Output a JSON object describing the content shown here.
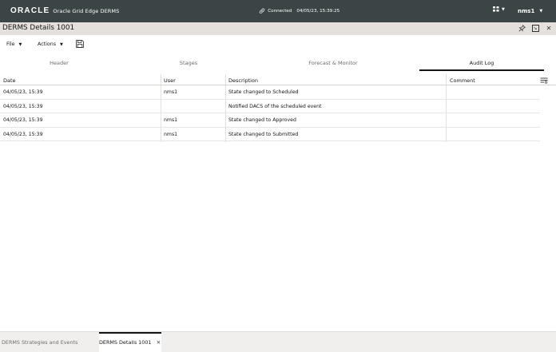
{
  "topbar": {
    "logo": "ORACLE",
    "app_name": "Oracle Grid Edge DERMS",
    "connection_status": "Connected",
    "timestamp": "04/05/23, 15:39:25",
    "user": "nms1",
    "grid_icon": "apps-grid-icon",
    "colors": {
      "bar_bg": "#3c4545",
      "text": "#ffffff"
    }
  },
  "window": {
    "title": "DERMS Details 1001",
    "controls": [
      "pin-icon",
      "maximize-icon",
      "close-icon"
    ]
  },
  "toolbar": {
    "file_label": "File",
    "actions_label": "Actions",
    "save_icon": "save-icon"
  },
  "tabs": [
    {
      "label": "Header",
      "active": false
    },
    {
      "label": "Stages",
      "active": false
    },
    {
      "label": "Forecast & Monitor",
      "active": false
    },
    {
      "label": "Audit Log",
      "active": true
    }
  ],
  "audit_table": {
    "columns": [
      "Date",
      "User",
      "Description",
      "Comment"
    ],
    "rows": [
      {
        "date": "04/05/23, 15:39",
        "user": "nms1",
        "description": "State changed to Scheduled",
        "comment": ""
      },
      {
        "date": "04/05/23, 15:39",
        "user": "",
        "description": "Notified DACS of the scheduled event",
        "comment": ""
      },
      {
        "date": "04/05/23, 15:39",
        "user": "nms1",
        "description": "State changed to Approved",
        "comment": ""
      },
      {
        "date": "04/05/23, 15:39",
        "user": "nms1",
        "description": "State changed to Submitted",
        "comment": ""
      }
    ]
  },
  "bottom_tabs": [
    {
      "label": "DERMS Strategies and Events",
      "active": false
    },
    {
      "label": "DERMS Details 1001",
      "active": true,
      "closable": true
    }
  ]
}
